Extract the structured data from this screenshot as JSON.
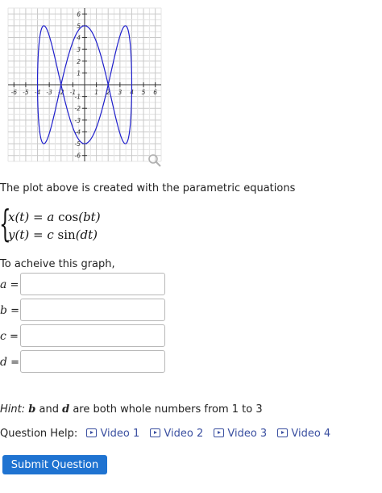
{
  "graph": {
    "x_ticks": [
      "-6",
      "-5",
      "-4",
      "-3",
      "-2",
      "-1",
      "1",
      "2",
      "3",
      "4",
      "5",
      "6"
    ],
    "y_ticks": [
      "6",
      "5",
      "4",
      "3",
      "2",
      "1",
      "-1",
      "-2",
      "-3",
      "-4",
      "-5",
      "-6"
    ],
    "curve_color": "#1f1fcc",
    "zoom_icon": "magnifier-icon"
  },
  "chart_data": {
    "type": "line",
    "xlim": [
      -6.5,
      6.5
    ],
    "ylim": [
      -6.5,
      6.5
    ],
    "grid": true,
    "series": [
      {
        "x_of_t": "4*cos(t)",
        "y_of_t": "5*sin(3*t)",
        "t_range": [
          0,
          6.283
        ]
      }
    ]
  },
  "intro_text": "The plot above is created with the parametric equations",
  "equations": {
    "line1": {
      "lhs": "x(t)",
      "eq": "=",
      "coef": "a",
      "fn": "cos",
      "arg": "(bt)"
    },
    "line2": {
      "lhs": "y(t)",
      "eq": "=",
      "coef": "c",
      "fn": "sin",
      "arg": "(dt)"
    }
  },
  "achieve_text": "To acheive this graph,",
  "fields": [
    {
      "var": "a",
      "eq": "=",
      "value": ""
    },
    {
      "var": "b",
      "eq": "=",
      "value": ""
    },
    {
      "var": "c",
      "eq": "=",
      "value": ""
    },
    {
      "var": "d",
      "eq": "=",
      "value": ""
    }
  ],
  "hint": {
    "label": "Hint:",
    "var1": "b",
    "and": "and",
    "var2": "d",
    "rest": "are both whole numbers from 1 to 3"
  },
  "question_help": {
    "label": "Question Help:",
    "videos": [
      "Video 1",
      "Video 2",
      "Video 3",
      "Video 4"
    ]
  },
  "submit_label": "Submit Question"
}
